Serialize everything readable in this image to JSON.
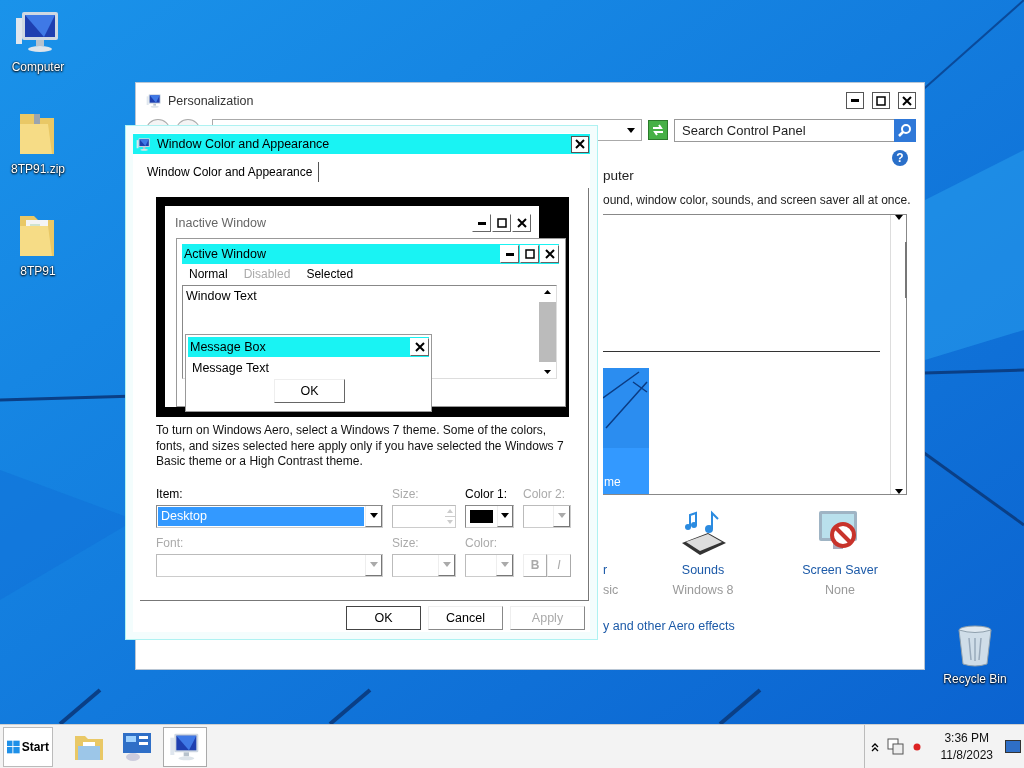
{
  "desktop": {
    "icons": [
      {
        "label": "Computer",
        "kind": "computer"
      },
      {
        "label": "8TP91.zip",
        "kind": "zip"
      },
      {
        "label": "8TP91",
        "kind": "folder"
      },
      {
        "label": "Recycle Bin",
        "kind": "recycle"
      }
    ]
  },
  "personalization": {
    "title": "Personalization",
    "search": {
      "placeholder": "Search Control Panel"
    },
    "help": "?",
    "heading": "puter",
    "description": "ound, window color, sounds, and screen saver all at once.",
    "theme_tile": {
      "label": "me",
      "selected": true
    },
    "settings": [
      {
        "label": "r",
        "value": "sic",
        "kind": "color"
      },
      {
        "label": "Sounds",
        "value": "Windows 8",
        "kind": "sounds"
      },
      {
        "label": "Screen Saver",
        "value": "None",
        "kind": "screensaver"
      }
    ],
    "link": "y and other Aero effects"
  },
  "dialog": {
    "title": "Window Color and Appearance",
    "tabs": [
      {
        "label": "Window Color and Appearance",
        "selected": true
      }
    ],
    "preview": {
      "inactive_title": "Inactive Window",
      "active_title": "Active Window",
      "menu": [
        {
          "label": "Normal",
          "kind": "normal"
        },
        {
          "label": "Disabled",
          "kind": "disabled"
        },
        {
          "label": "Selected",
          "kind": "selected"
        }
      ],
      "window_text": "Window Text",
      "message_title": "Message Box",
      "message_text": "Message Text",
      "message_button": "OK"
    },
    "note": "To turn on Windows Aero, select a Windows 7 theme.  Some of the colors, fonts, and sizes selected here apply only if you have selected the Windows 7 Basic theme or a High Contrast theme.",
    "fields": [
      {
        "label": "Item:",
        "kind": "combo",
        "value": "Desktop",
        "disabled": false
      },
      {
        "label": "Size:",
        "kind": "spin",
        "disabled": true
      },
      {
        "label": "Color 1:",
        "kind": "color",
        "color": "#000000",
        "disabled": false
      },
      {
        "label": "Color 2:",
        "kind": "color",
        "disabled": true
      },
      {
        "label": "Font:",
        "kind": "combo",
        "disabled": true
      },
      {
        "label": "Size:",
        "kind": "combo",
        "disabled": true
      },
      {
        "label": "Color:",
        "kind": "color",
        "disabled": true
      },
      {
        "kind": "style",
        "labels": [
          "B",
          "I"
        ],
        "disabled": true
      }
    ],
    "buttons": [
      {
        "label": "OK",
        "disabled": false
      },
      {
        "label": "Cancel",
        "disabled": false
      },
      {
        "label": "Apply",
        "disabled": true
      }
    ]
  },
  "taskbar": {
    "start": "Start",
    "apps": [
      {
        "kind": "explorer",
        "selected": false
      },
      {
        "kind": "control-panel",
        "selected": false
      },
      {
        "kind": "personalization",
        "selected": true
      }
    ],
    "time": "3:36 PM",
    "date": "11/8/2023"
  }
}
